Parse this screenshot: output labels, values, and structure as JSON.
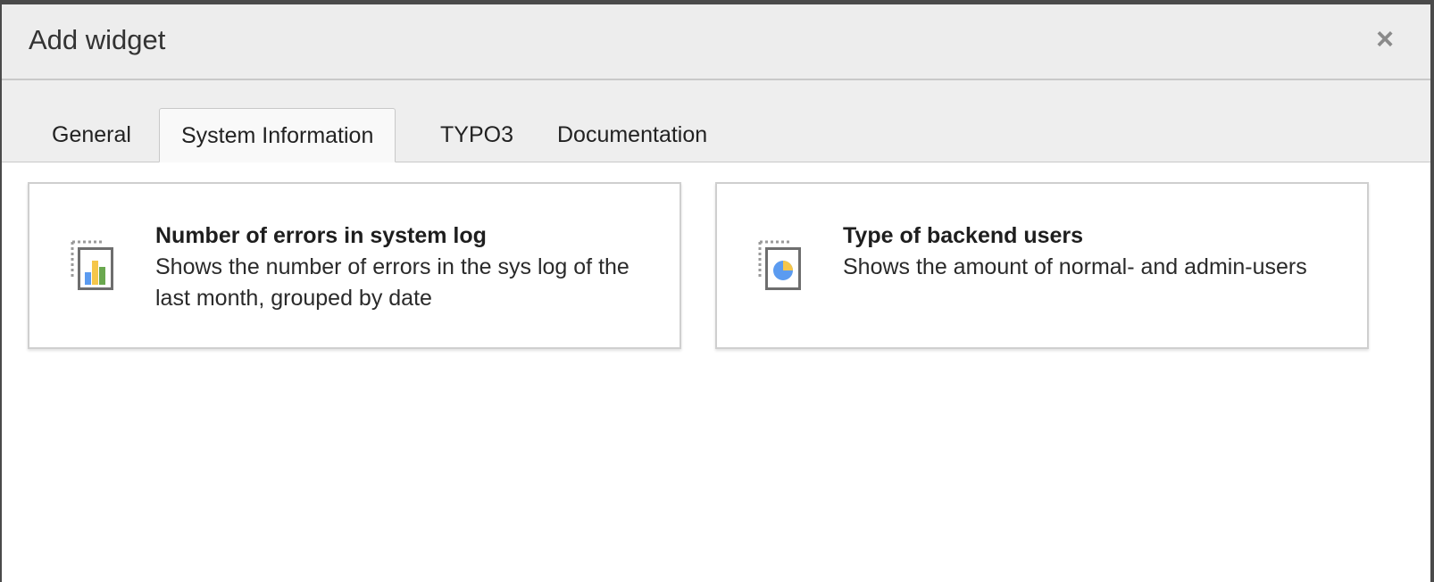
{
  "modal": {
    "title": "Add widget",
    "close_symbol": "×"
  },
  "tabs": [
    {
      "label": "General",
      "active": false
    },
    {
      "label": "System Information",
      "active": true
    },
    {
      "label": "TYPO3",
      "active": false
    },
    {
      "label": "Documentation",
      "active": false
    }
  ],
  "widgets": [
    {
      "icon": "bar-chart-widget-icon",
      "title": "Number of errors in system log",
      "description": "Shows the number of errors in the sys log of the last month, grouped by date"
    },
    {
      "icon": "pie-chart-widget-icon",
      "title": "Type of backend users",
      "description": "Shows the amount of normal- and admin-users"
    }
  ],
  "colors": {
    "header_bg": "#ededed",
    "tab_active_bg": "#f9f9f9",
    "chart_blue": "#5b9bf0",
    "chart_yellow": "#f5c64a",
    "chart_green": "#6aa84f"
  }
}
